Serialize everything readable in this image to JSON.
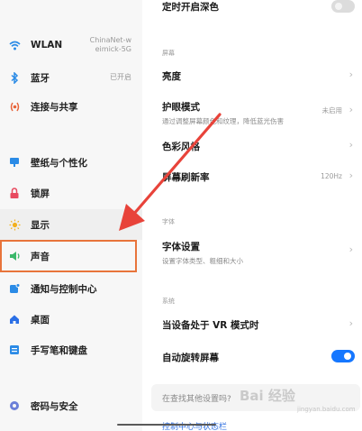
{
  "sidebar": {
    "items": [
      {
        "label": "WLAN",
        "value": "ChinaNet-w\neimick-5G",
        "icon": "wifi-icon"
      },
      {
        "label": "蓝牙",
        "value": "已开启",
        "icon": "bluetooth-icon"
      },
      {
        "label": "连接与共享",
        "value": "",
        "icon": "share-icon"
      },
      {
        "label": "壁纸与个性化",
        "value": "",
        "icon": "wallpaper-icon"
      },
      {
        "label": "锁屏",
        "value": "",
        "icon": "lock-icon"
      },
      {
        "label": "显示",
        "value": "",
        "icon": "sun-icon"
      },
      {
        "label": "声音",
        "value": "",
        "icon": "speaker-icon"
      },
      {
        "label": "通知与控制中心",
        "value": "",
        "icon": "notification-icon"
      },
      {
        "label": "桌面",
        "value": "",
        "icon": "home-icon"
      },
      {
        "label": "手写笔和键盘",
        "value": "",
        "icon": "keyboard-icon"
      },
      {
        "label": "密码与安全",
        "value": "",
        "icon": "security-icon"
      }
    ]
  },
  "panel": {
    "top_row": {
      "title": "定时开启深色",
      "toggle": false
    },
    "section_screen": "屏幕",
    "brightness": {
      "title": "亮度"
    },
    "eye_care": {
      "title": "护眼模式",
      "subtitle": "通过调整屏幕颜色和纹理，降低蓝光伤害",
      "value": "未启用"
    },
    "color_style": {
      "title": "色彩风格"
    },
    "refresh_rate": {
      "title": "屏幕刷新率",
      "value": "120Hz"
    },
    "section_font": "字体",
    "font_settings": {
      "title": "字体设置",
      "subtitle": "设置字体类型、粗细和大小"
    },
    "section_system": "系统",
    "vr_mode": {
      "title": "当设备处于 VR 模式时"
    },
    "auto_rotate": {
      "title": "自动旋转屏幕",
      "toggle": true
    },
    "search_prompt": "在查找其他设置吗?",
    "bottom_link": "控制中心与状态栏"
  },
  "watermark": {
    "text": "Bai 经验",
    "sub": "jingyan.baidu.com"
  },
  "colors": {
    "accent": "#1677ff",
    "highlight_box": "#e8743b",
    "arrow": "#e8433a"
  }
}
